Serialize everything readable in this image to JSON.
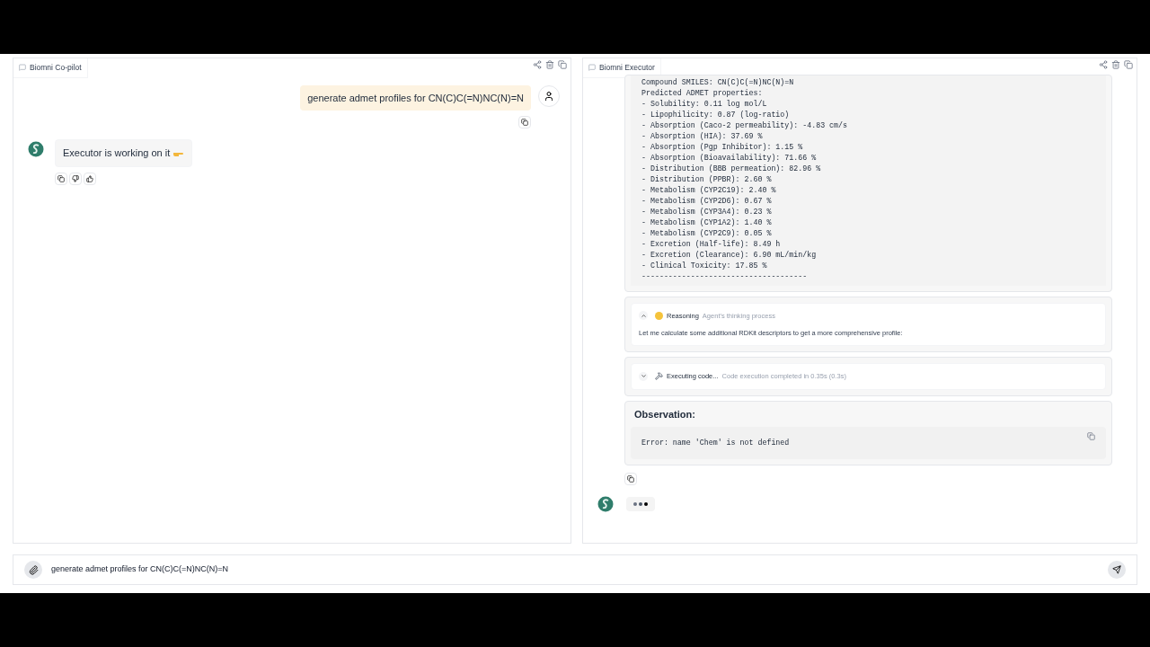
{
  "copilot": {
    "title": "Biomni Co-pilot",
    "messages": [
      {
        "kind": "user",
        "text": "generate admet profiles for CN(C)C(=N)NC(N)=N"
      },
      {
        "kind": "assistant",
        "text": "Executor is working on it"
      }
    ]
  },
  "executor": {
    "title": "Biomni Executor",
    "output_lines": [
      "Compound SMILES: CN(C)C(=N)NC(N)=N",
      "Predicted ADMET properties:",
      "- Solubility: 0.11 log mol/L",
      "- Lipophilicity: 0.87 (log-ratio)",
      "- Absorption (Caco-2 permeability): -4.83 cm/s",
      "- Absorption (HIA): 37.69 %",
      "- Absorption (Pgp Inhibitor): 1.15 %",
      "- Absorption (Bioavailability): 71.66 %",
      "- Distribution (BBB permeation): 82.96 %",
      "- Distribution (PPBR): 2.60 %",
      "- Metabolism (CYP2C19): 2.40 %",
      "- Metabolism (CYP2D6): 0.67 %",
      "- Metabolism (CYP3A4): 0.23 %",
      "- Metabolism (CYP1A2): 1.40 %",
      "- Metabolism (CYP2C9): 0.05 %",
      "- Excretion (Half-life): 8.49 h",
      "- Excretion (Clearance): 6.90 mL/min/kg",
      "- Clinical Toxicity: 17.85 %",
      "-------------------------------------"
    ],
    "steps": [
      {
        "kind": "reasoning",
        "title": "Reasoning",
        "subtitle": "Agent's thinking process",
        "expanded": true,
        "body": "Let me calculate some additional RDKit descriptors to get a more comprehensive profile:"
      },
      {
        "kind": "code",
        "title": "Executing code...",
        "subtitle": "Code execution completed in 0.35s (0.3s)",
        "expanded": false
      }
    ],
    "observation": {
      "heading": "Observation:",
      "text": "Error: name 'Chem' is not defined"
    }
  },
  "composer": {
    "value": "generate admet profiles for CN(C)C(=N)NC(N)=N"
  }
}
